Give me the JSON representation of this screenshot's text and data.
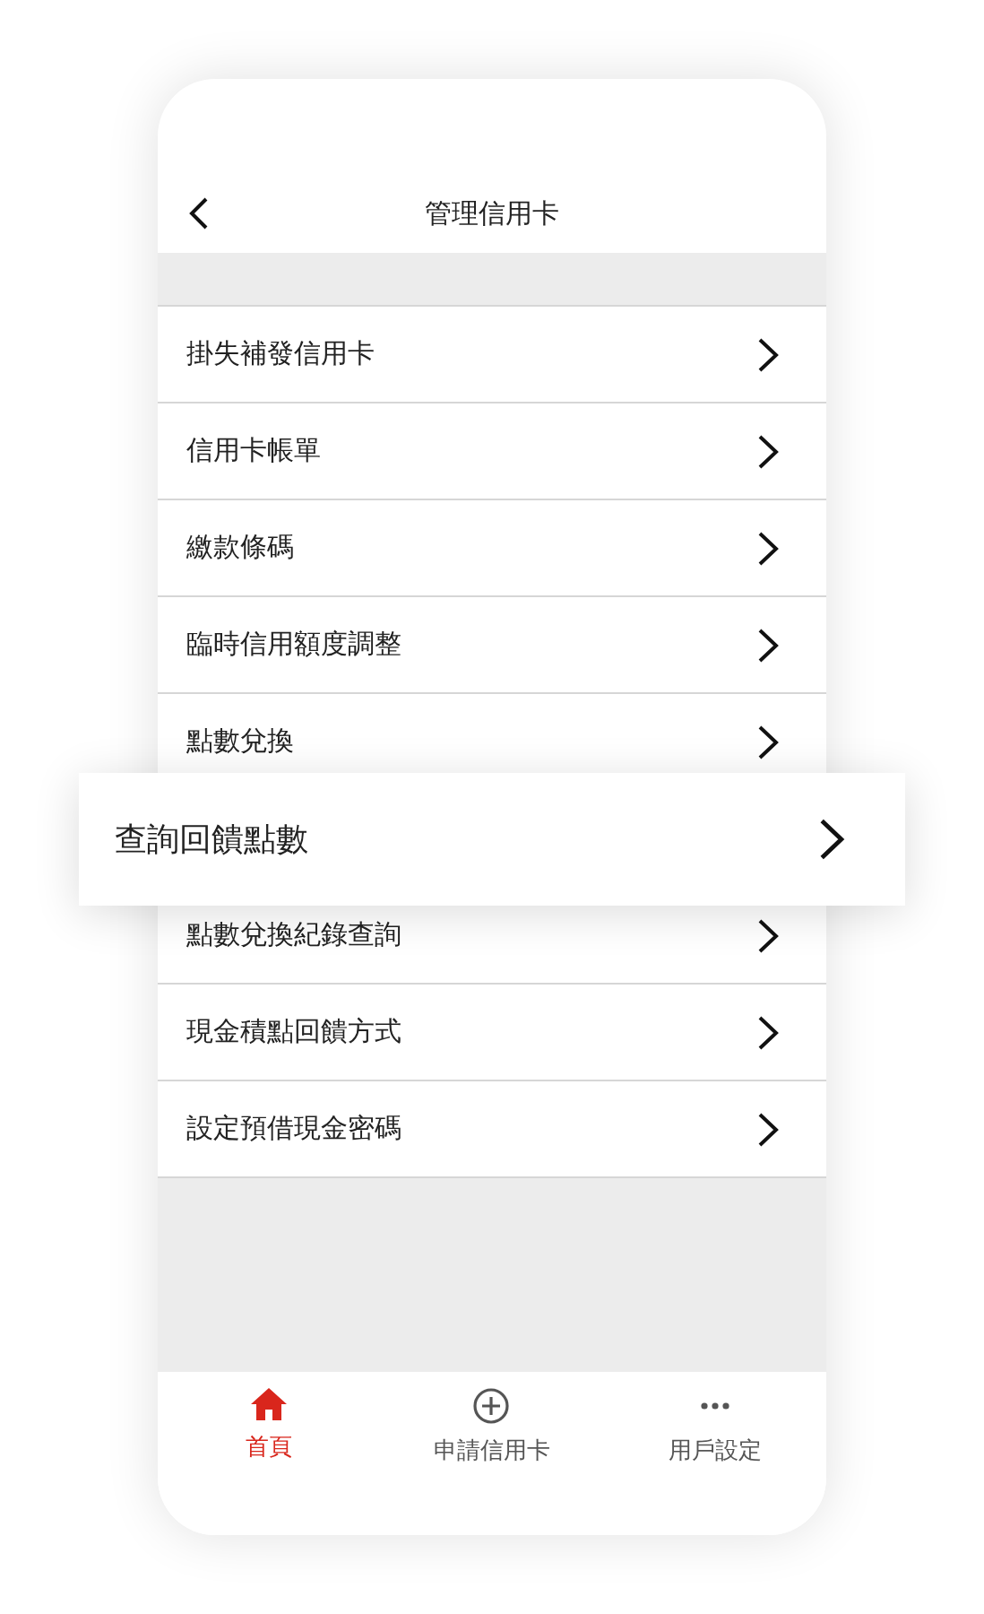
{
  "header": {
    "title": "管理信用卡"
  },
  "menu": [
    {
      "label": "掛失補發信用卡",
      "highlighted": false
    },
    {
      "label": "信用卡帳單",
      "highlighted": false
    },
    {
      "label": "繳款條碼",
      "highlighted": false
    },
    {
      "label": "臨時信用額度調整",
      "highlighted": false
    },
    {
      "label": "點數兌換",
      "highlighted": false
    },
    {
      "label": "查詢回饋點數",
      "highlighted": true
    },
    {
      "label": "點數兌換紀錄查詢",
      "highlighted": false
    },
    {
      "label": "現金積點回饋方式",
      "highlighted": false
    },
    {
      "label": "設定預借現金密碼",
      "highlighted": false
    }
  ],
  "tab_bar": [
    {
      "kind": "home",
      "label": "首頁",
      "selected": true
    },
    {
      "kind": "plus",
      "label": "申請信用卡",
      "selected": false
    },
    {
      "kind": "more",
      "label": "用戶設定",
      "selected": false
    }
  ]
}
